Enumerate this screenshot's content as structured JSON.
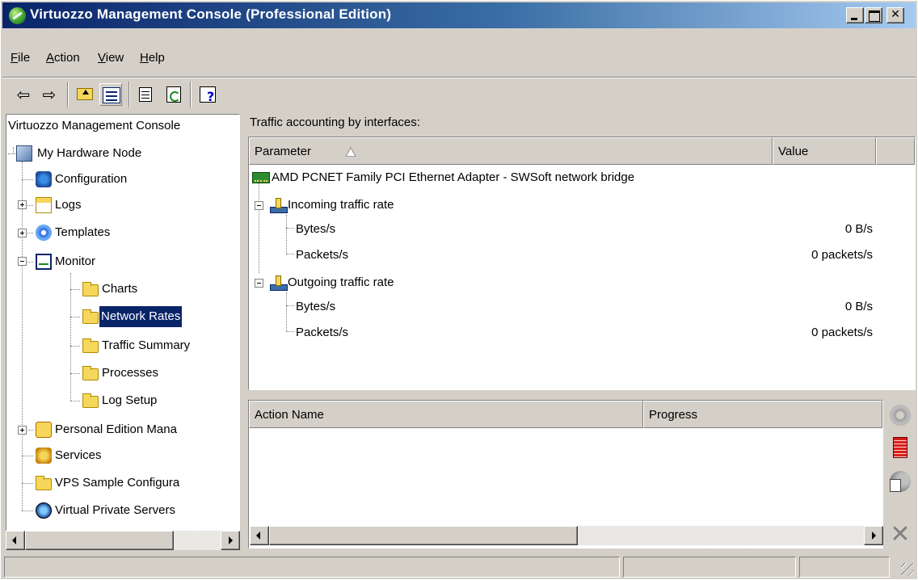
{
  "window": {
    "title": "Virtuozzo Management Console (Professional Edition)"
  },
  "menu": [
    {
      "label": "File",
      "accel": "F"
    },
    {
      "label": "Action",
      "accel": "A"
    },
    {
      "label": "View",
      "accel": "V"
    },
    {
      "label": "Help",
      "accel": "H"
    }
  ],
  "titlebar_buttons": {
    "close": "✕"
  },
  "toolbar": {
    "back": "⇦",
    "forward": "⇨"
  },
  "tree": {
    "header": "Virtuozzo Management Console",
    "items": [
      {
        "label": "My Hardware Node",
        "icon": "server-icon"
      },
      {
        "label": "Configuration",
        "icon": "configuration-icon"
      },
      {
        "label": "Logs",
        "icon": "logs-icon"
      },
      {
        "label": "Templates",
        "icon": "templates-icon"
      },
      {
        "label": "Monitor",
        "icon": "monitor-icon"
      },
      {
        "label": "Charts",
        "icon": "folder-icon"
      },
      {
        "label": "Network Rates",
        "icon": "folder-icon",
        "selected": true
      },
      {
        "label": "Traffic Summary",
        "icon": "folder-icon"
      },
      {
        "label": "Processes",
        "icon": "folder-icon"
      },
      {
        "label": "Log Setup",
        "icon": "folder-icon"
      },
      {
        "label": "Personal Edition Mana",
        "icon": "personal-edition-icon"
      },
      {
        "label": "Services",
        "icon": "services-icon"
      },
      {
        "label": "VPS Sample Configura",
        "icon": "folder-icon"
      },
      {
        "label": "Virtual Private Servers",
        "icon": "vps-icon"
      }
    ]
  },
  "traffic": {
    "caption": "Traffic accounting by interfaces:",
    "columns": {
      "parameter": "Parameter",
      "value": "Value"
    },
    "adapter": "AMD PCNET Family PCI Ethernet Adapter - SWSoft network bridge",
    "incoming": {
      "label": "Incoming traffic rate",
      "bytes_label": "Bytes/s",
      "bytes_value": "0 B/s",
      "packets_label": "Packets/s",
      "packets_value": "0 packets/s"
    },
    "outgoing": {
      "label": "Outgoing traffic rate",
      "bytes_label": "Bytes/s",
      "bytes_value": "0 B/s",
      "packets_label": "Packets/s",
      "packets_value": "0 packets/s"
    }
  },
  "actions": {
    "columns": {
      "name": "Action Name",
      "progress": "Progress"
    },
    "icons": [
      "settings-gear-icon",
      "stop-icon",
      "configure-icon",
      "cancel-x-icon"
    ],
    "cancel_glyph": "✕"
  },
  "status_bar": {
    "panels": [
      "",
      "",
      ""
    ]
  }
}
